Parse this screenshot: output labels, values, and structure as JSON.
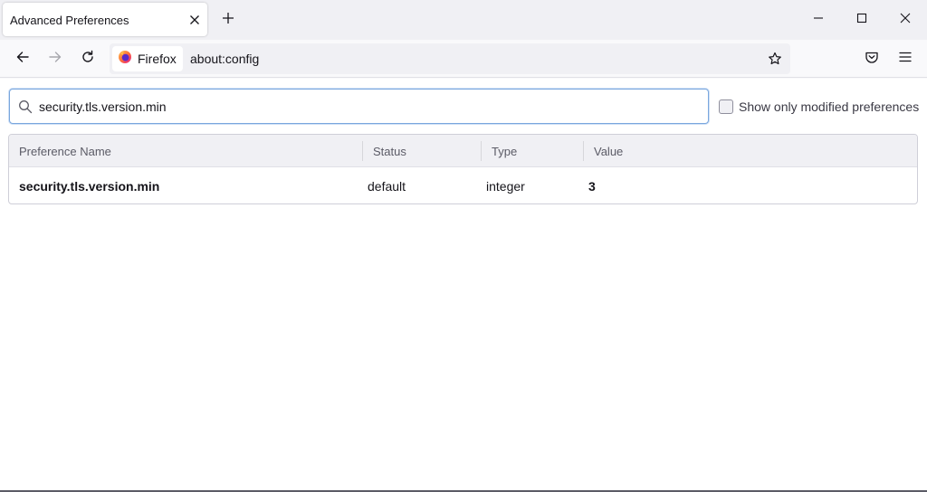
{
  "tab": {
    "title": "Advanced Preferences"
  },
  "navbar": {
    "identity_label": "Firefox",
    "url": "about:config"
  },
  "search": {
    "value": "security.tls.version.min"
  },
  "modified_filter": {
    "label": "Show only modified preferences",
    "checked": false
  },
  "table": {
    "columns": [
      "Preference Name",
      "Status",
      "Type",
      "Value"
    ],
    "rows": [
      {
        "name": "security.tls.version.min",
        "status": "default",
        "type": "integer",
        "value": "3"
      }
    ]
  },
  "icons": {
    "tab_close": "close-icon",
    "new_tab": "plus-icon",
    "back": "arrow-left-icon",
    "forward": "arrow-right-icon",
    "reload": "reload-icon",
    "bookmark": "star-icon",
    "pocket": "pocket-icon",
    "menu": "hamburger-icon",
    "search": "search-icon"
  },
  "colors": {
    "accent_focus": "#7aa7de",
    "firefox_orange": "#ff7139",
    "firefox_purple": "#592acb"
  }
}
